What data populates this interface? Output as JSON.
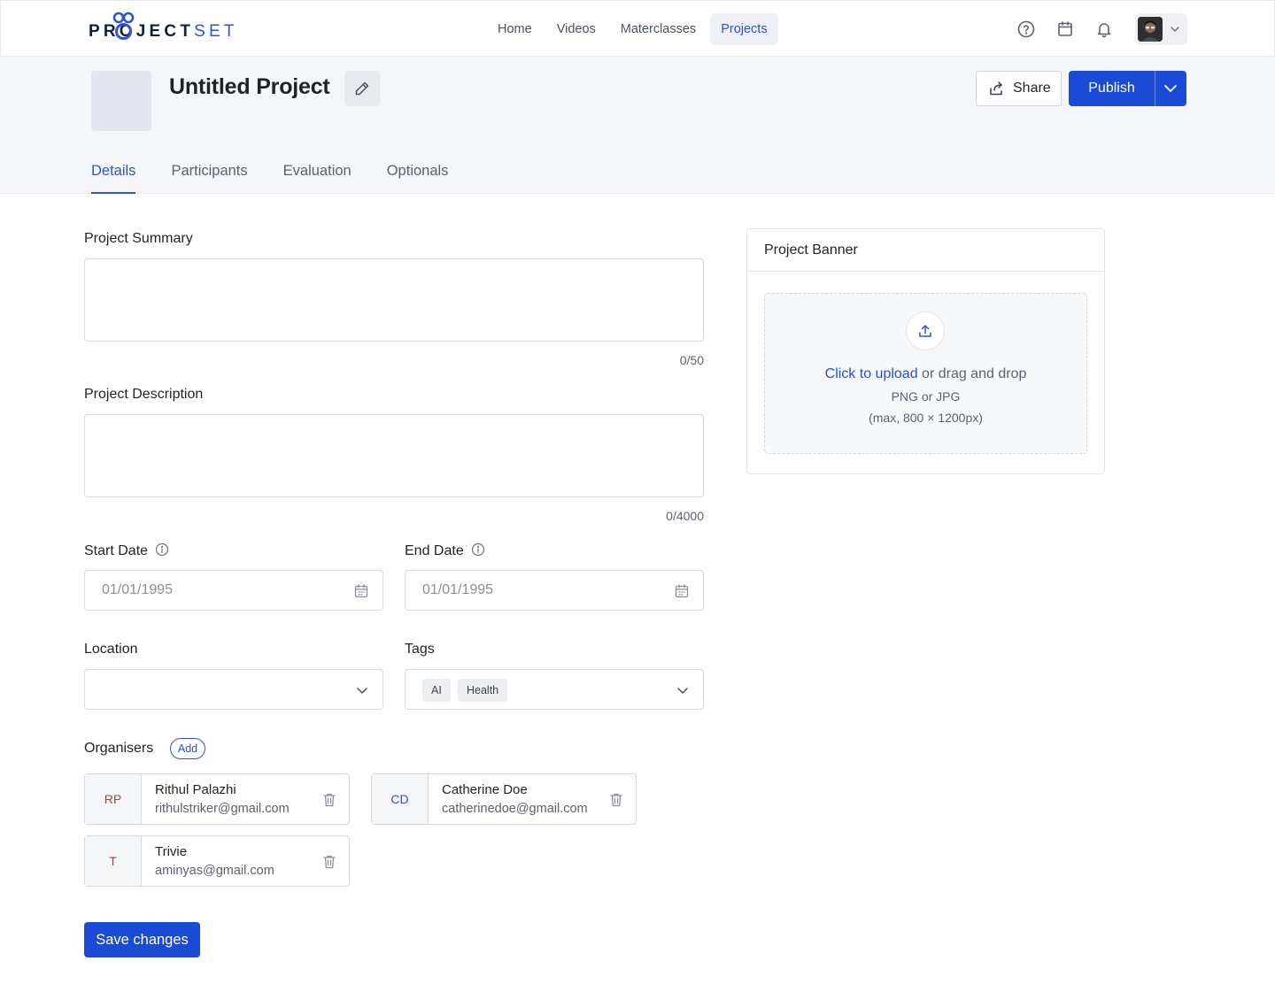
{
  "brand": {
    "logo_dark": "PROJECT",
    "logo_light": "SET"
  },
  "nav": {
    "items": [
      {
        "label": "Home",
        "active": false
      },
      {
        "label": "Videos",
        "active": false
      },
      {
        "label": "Materclasses",
        "active": false
      },
      {
        "label": "Projects",
        "active": true
      }
    ]
  },
  "top_icons": [
    "help-circle-icon",
    "calendar-icon",
    "bell-icon"
  ],
  "project": {
    "title": "Untitled Project",
    "share_label": "Share",
    "publish_label": "Publish"
  },
  "tabs": [
    {
      "label": "Details",
      "active": true
    },
    {
      "label": "Participants",
      "active": false
    },
    {
      "label": "Evaluation",
      "active": false
    },
    {
      "label": "Optionals",
      "active": false
    }
  ],
  "form": {
    "summary": {
      "label": "Project Summary",
      "value": "",
      "counter": "0/50"
    },
    "description": {
      "label": "Project Description",
      "value": "",
      "counter": "0/4000"
    },
    "start_date": {
      "label": "Start Date",
      "placeholder": "01/01/1995"
    },
    "end_date": {
      "label": "End Date",
      "placeholder": "01/01/1995"
    },
    "location": {
      "label": "Location",
      "value": ""
    },
    "tags": {
      "label": "Tags",
      "selected": [
        "AI",
        "Health"
      ]
    },
    "organisers": {
      "label": "Organisers",
      "add_label": "Add",
      "people": [
        {
          "initials": "RP",
          "name": "Rithul Palazhi",
          "email": "rithulstriker@gmail.com",
          "color": "#c0392b"
        },
        {
          "initials": "CD",
          "name": "Catherine Doe",
          "email": "catherinedoe@gmail.com",
          "color": "#3153d4"
        },
        {
          "initials": "T",
          "name": "Trivie",
          "email": "aminyas@gmail.com",
          "color": "#c0392b"
        }
      ]
    },
    "save_label": "Save changes"
  },
  "banner": {
    "title": "Project Banner",
    "upload_link": "Click to upload",
    "upload_rest": " or drag and drop",
    "formats": "PNG or JPG",
    "size_hint": "(max, 800 × 1200px)"
  },
  "colors": {
    "primary": "#1a4bd6",
    "accent": "#3153d4",
    "header_bg": "#f5f6fa"
  }
}
